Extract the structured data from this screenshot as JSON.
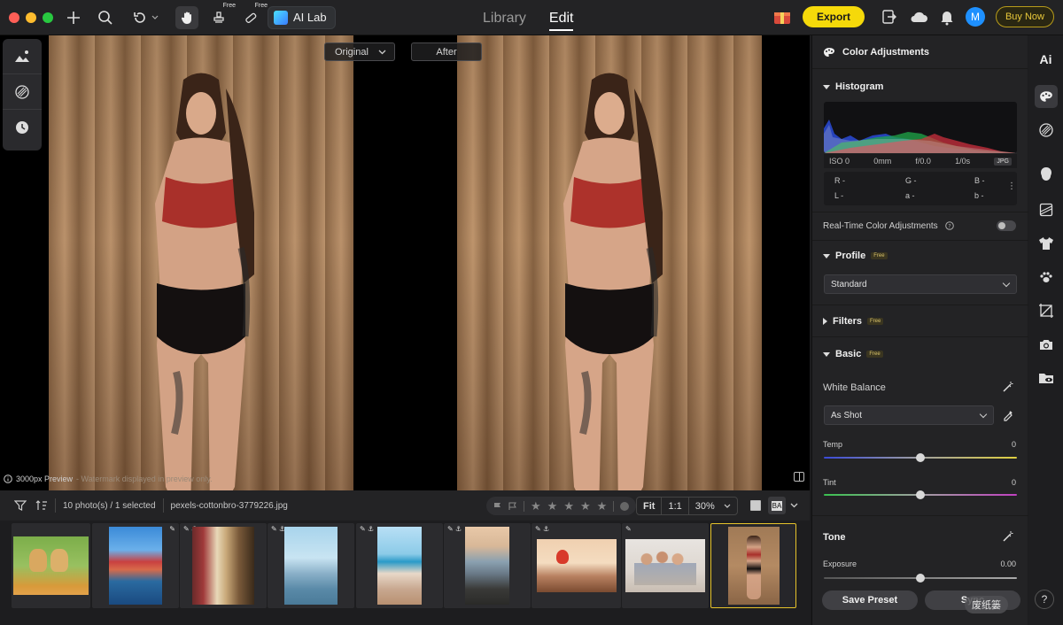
{
  "titlebar": {
    "free_badge": "Free",
    "ai_lab_label": "AI Lab",
    "tabs": [
      {
        "label": "Library"
      },
      {
        "label": "Edit"
      }
    ],
    "export_label": "Export",
    "avatar_initial": "M",
    "buy_now_label": "Buy Now",
    "traffic_colors": [
      "#ff5f57",
      "#febc2e",
      "#28c840"
    ],
    "accent_color": "#f5d90a"
  },
  "canvas": {
    "original_label": "Original",
    "after_label": "After",
    "preview_size": "3000px Preview",
    "watermark_note": "- Watermark displayed in preview only."
  },
  "filmstrip": {
    "count_text": "10 photo(s) / 1 selected",
    "filename": "pexels-cottonbro-3779226.jpg",
    "zoom_fit": "Fit",
    "zoom_1to1": "1:1",
    "zoom_percent": "30%",
    "ba_label": "BA"
  },
  "panel": {
    "header": "Color Adjustments",
    "histogram_title": "Histogram",
    "exif": {
      "iso": "ISO 0",
      "focal": "0mm",
      "aperture": "f/0.0",
      "shutter": "1/0s",
      "format": "JPG"
    },
    "rgb": {
      "r": "R -",
      "g": "G -",
      "b": "B -",
      "l": "L -",
      "a": "a -",
      "b2": "b -"
    },
    "realtime_label": "Real-Time Color Adjustments",
    "profile_title": "Profile",
    "free_tag": "Free",
    "profile_value": "Standard",
    "filters_title": "Filters",
    "basic_title": "Basic",
    "white_balance_label": "White Balance",
    "wb_value": "As Shot",
    "temp_label": "Temp",
    "temp_value": "0",
    "tint_label": "Tint",
    "tint_value": "0",
    "tone_title": "Tone",
    "exposure_label": "Exposure",
    "exposure_value": "0.00",
    "save_preset_label": "Save Preset",
    "sync_label": "Sync"
  },
  "rail": {
    "ai_label": "Ai"
  },
  "overlay": {
    "watermark_text": "废纸篓",
    "help": "?"
  }
}
